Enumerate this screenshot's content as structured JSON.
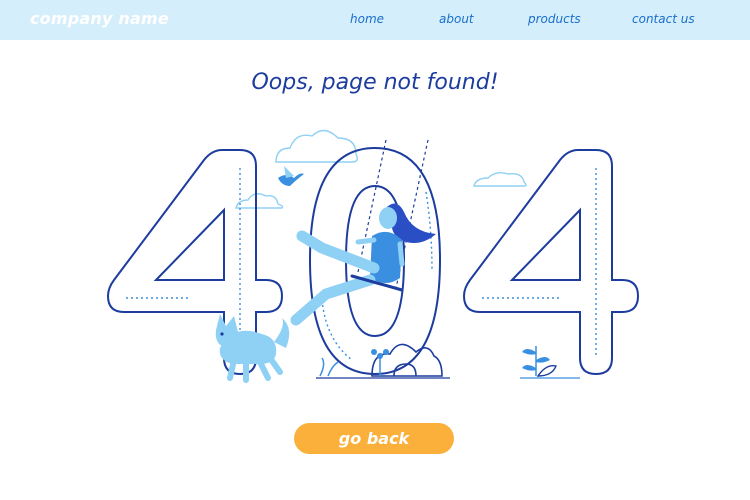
{
  "header": {
    "brand": "company name",
    "nav": [
      {
        "label": "home"
      },
      {
        "label": "about"
      },
      {
        "label": "products"
      },
      {
        "label": "contact us"
      }
    ]
  },
  "main": {
    "title": "Oops, page not found!",
    "button_label": "go back",
    "illustration": {
      "digits": [
        "4",
        "0",
        "4"
      ],
      "elements": [
        "cloud",
        "bird",
        "woman-on-swing",
        "dog",
        "plants"
      ]
    }
  },
  "colors": {
    "nav_background": "#d4eefc",
    "nav_link": "#1a6fc9",
    "title": "#1c3c9e",
    "outline": "#1c3c9e",
    "accent_light": "#8fd0f5",
    "accent": "#3a8fe0",
    "button": "#fbb03b"
  }
}
